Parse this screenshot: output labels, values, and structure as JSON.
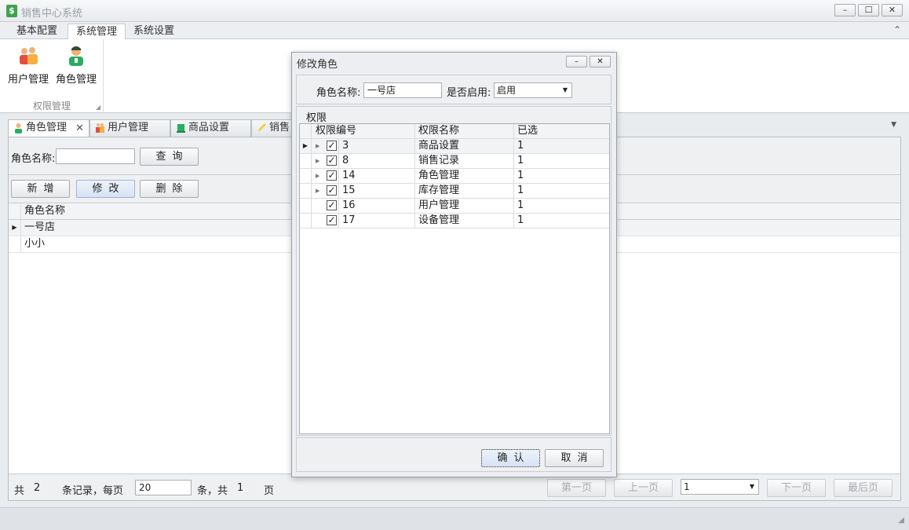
{
  "window": {
    "title": "销售中心系统",
    "app_icon": "$",
    "minimize": "–",
    "maximize": "☐",
    "close": "✕"
  },
  "ribbon": {
    "tabs": [
      "基本配置",
      "系统管理",
      "系统设置"
    ],
    "active_tab": "系统管理",
    "collapse_icon": "chevron-up-icon",
    "buttons": [
      {
        "label": "用户管理",
        "icon": "users-icon"
      },
      {
        "label": "角色管理",
        "icon": "role-icon"
      }
    ],
    "group_label": "权限管理"
  },
  "doc_tabs": [
    {
      "label": "角色管理",
      "icon": "role-icon",
      "active": true
    },
    {
      "label": "用户管理",
      "icon": "users-icon"
    },
    {
      "label": "商品设置",
      "icon": "goods-icon"
    },
    {
      "label": "销售",
      "icon": "pencil-icon"
    }
  ],
  "search": {
    "label": "角色名称:",
    "value": "",
    "button": "查询"
  },
  "toolbar": {
    "add": "新增",
    "edit": "修改",
    "delete": "删除"
  },
  "grid": {
    "column": "角色名称",
    "rows": [
      "一号店",
      "小小"
    ]
  },
  "pager": {
    "total_prefix": "共",
    "total": "2",
    "per_page_text": "条记录，每页",
    "per_page": "20",
    "pages_text": "条，共",
    "pages": "1",
    "page_unit": "页",
    "first": "第一页",
    "prev": "上一页",
    "current": "1",
    "next": "下一页",
    "last": "最后页"
  },
  "dialog": {
    "title": "修改角色",
    "role_name_label": "角色名称:",
    "role_name_value": "一号店",
    "enabled_label": "是否启用:",
    "enabled_value": "启用",
    "permissions_caption": "权限",
    "columns": [
      "权限编号",
      "权限名称",
      "已选"
    ],
    "rows": [
      {
        "id": "3",
        "name": "商品设置",
        "selected": "1",
        "expandable": true,
        "current": true
      },
      {
        "id": "8",
        "name": "销售记录",
        "selected": "1",
        "expandable": true
      },
      {
        "id": "14",
        "name": "角色管理",
        "selected": "1",
        "expandable": true
      },
      {
        "id": "15",
        "name": "库存管理",
        "selected": "1",
        "expandable": true
      },
      {
        "id": "16",
        "name": "用户管理",
        "selected": "1",
        "expandable": false
      },
      {
        "id": "17",
        "name": "设备管理",
        "selected": "1",
        "expandable": false
      }
    ],
    "confirm": "确认",
    "cancel": "取消"
  }
}
